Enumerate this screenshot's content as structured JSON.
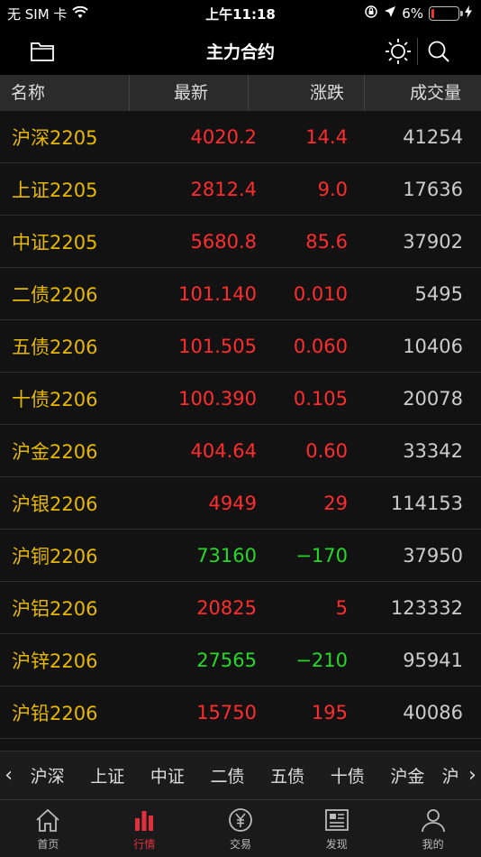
{
  "status_bar": {
    "carrier": "无 SIM 卡",
    "time": "上午11:18",
    "battery": "6%"
  },
  "nav": {
    "title": "主力合约"
  },
  "table": {
    "headers": [
      "名称",
      "最新",
      "涨跌",
      "成交量"
    ],
    "rows": [
      {
        "name": "沪深2205",
        "price": "4020.2",
        "change": "14.4",
        "volume": "41254",
        "trend": "up"
      },
      {
        "name": "上证2205",
        "price": "2812.4",
        "change": "9.0",
        "volume": "17636",
        "trend": "up"
      },
      {
        "name": "中证2205",
        "price": "5680.8",
        "change": "85.6",
        "volume": "37902",
        "trend": "up"
      },
      {
        "name": "二债2206",
        "price": "101.140",
        "change": "0.010",
        "volume": "5495",
        "trend": "up"
      },
      {
        "name": "五债2206",
        "price": "101.505",
        "change": "0.060",
        "volume": "10406",
        "trend": "up"
      },
      {
        "name": "十债2206",
        "price": "100.390",
        "change": "0.105",
        "volume": "20078",
        "trend": "up"
      },
      {
        "name": "沪金2206",
        "price": "404.64",
        "change": "0.60",
        "volume": "33342",
        "trend": "up"
      },
      {
        "name": "沪银2206",
        "price": "4949",
        "change": "29",
        "volume": "114153",
        "trend": "up"
      },
      {
        "name": "沪铜2206",
        "price": "73160",
        "change": "−170",
        "volume": "37950",
        "trend": "down"
      },
      {
        "name": "沪铝2206",
        "price": "20825",
        "change": "5",
        "volume": "123332",
        "trend": "up"
      },
      {
        "name": "沪锌2206",
        "price": "27565",
        "change": "−210",
        "volume": "95941",
        "trend": "down"
      },
      {
        "name": "沪铅2206",
        "price": "15750",
        "change": "195",
        "volume": "40086",
        "trend": "up"
      }
    ]
  },
  "ticker": {
    "items": [
      "沪深",
      "上证",
      "中证",
      "二债",
      "五债",
      "十债",
      "沪金",
      "沪"
    ]
  },
  "tabs": [
    {
      "label": "首页",
      "icon": "home-icon",
      "active": false
    },
    {
      "label": "行情",
      "icon": "market-bars-icon",
      "active": true
    },
    {
      "label": "交易",
      "icon": "yuan-icon",
      "active": false
    },
    {
      "label": "发现",
      "icon": "news-icon",
      "active": false
    },
    {
      "label": "我的",
      "icon": "user-icon",
      "active": false
    }
  ],
  "colors": {
    "up": "#ff2d2d",
    "down": "#27d927",
    "name": "#e6b800",
    "active_tab": "#e0303d"
  }
}
